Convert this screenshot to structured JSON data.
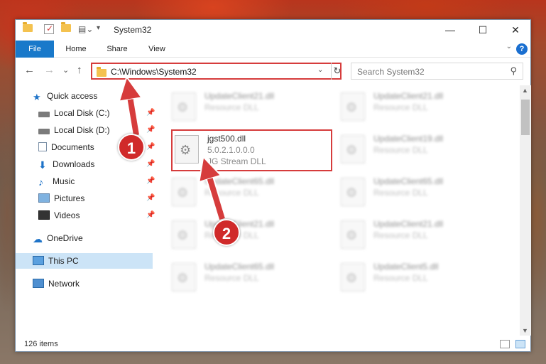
{
  "window": {
    "title": "System32",
    "controls": {
      "minimize": "—",
      "maximize": "☐",
      "close": "✕"
    }
  },
  "ribbon": {
    "tabs": [
      "File",
      "Home",
      "Share",
      "View"
    ],
    "help": "?"
  },
  "navigation": {
    "back": "←",
    "forward": "→",
    "recent": "⌄",
    "up": "↑",
    "address": "C:\\Windows\\System32",
    "refresh": "↻",
    "search_placeholder": "Search System32"
  },
  "sidebar": {
    "items": [
      {
        "label": "Quick access",
        "icon": "star-icon"
      },
      {
        "label": "Local Disk (C:)",
        "icon": "drive-icon",
        "pinned": true
      },
      {
        "label": "Local Disk (D:)",
        "icon": "drive-icon",
        "pinned": true
      },
      {
        "label": "Documents",
        "icon": "documents-icon",
        "pinned": true
      },
      {
        "label": "Downloads",
        "icon": "download-icon",
        "pinned": true
      },
      {
        "label": "Music",
        "icon": "music-icon",
        "pinned": true
      },
      {
        "label": "Pictures",
        "icon": "pictures-icon",
        "pinned": true
      },
      {
        "label": "Videos",
        "icon": "videos-icon",
        "pinned": true
      },
      {
        "label": "OneDrive",
        "icon": "cloud-icon"
      },
      {
        "label": "This PC",
        "icon": "computer-icon",
        "selected": true
      },
      {
        "label": "Network",
        "icon": "network-icon"
      }
    ]
  },
  "files": [
    {
      "name": "UpdateClient21.dll",
      "type": "Resource DLL",
      "blurred": true
    },
    {
      "name": "UpdateClient21.dll",
      "type": "Resource DLL",
      "blurred": true
    },
    {
      "name": "jgst500.dll",
      "version": "5.0.2.1.0.0.0",
      "type": "JG Stream DLL",
      "blurred": false,
      "highlighted": true
    },
    {
      "name": "UpdateClient19.dll",
      "type": "Resource DLL",
      "blurred": true
    },
    {
      "name": "UpdateClient65.dll",
      "type": "Resource DLL",
      "blurred": true
    },
    {
      "name": "UpdateClient65.dll",
      "type": "Resource DLL",
      "blurred": true
    },
    {
      "name": "UpdateClient21.dll",
      "type": "Resource DLL",
      "blurred": true
    },
    {
      "name": "UpdateClient21.dll",
      "type": "Resource DLL",
      "blurred": true
    },
    {
      "name": "UpdateClient65.dll",
      "type": "Resource DLL",
      "blurred": true
    },
    {
      "name": "UpdateClient5.dll",
      "type": "Resource DLL",
      "blurred": true
    }
  ],
  "status": {
    "item_count": "126 items"
  },
  "annotations": {
    "step1": "1",
    "step2": "2",
    "color": "#d63c3c"
  }
}
